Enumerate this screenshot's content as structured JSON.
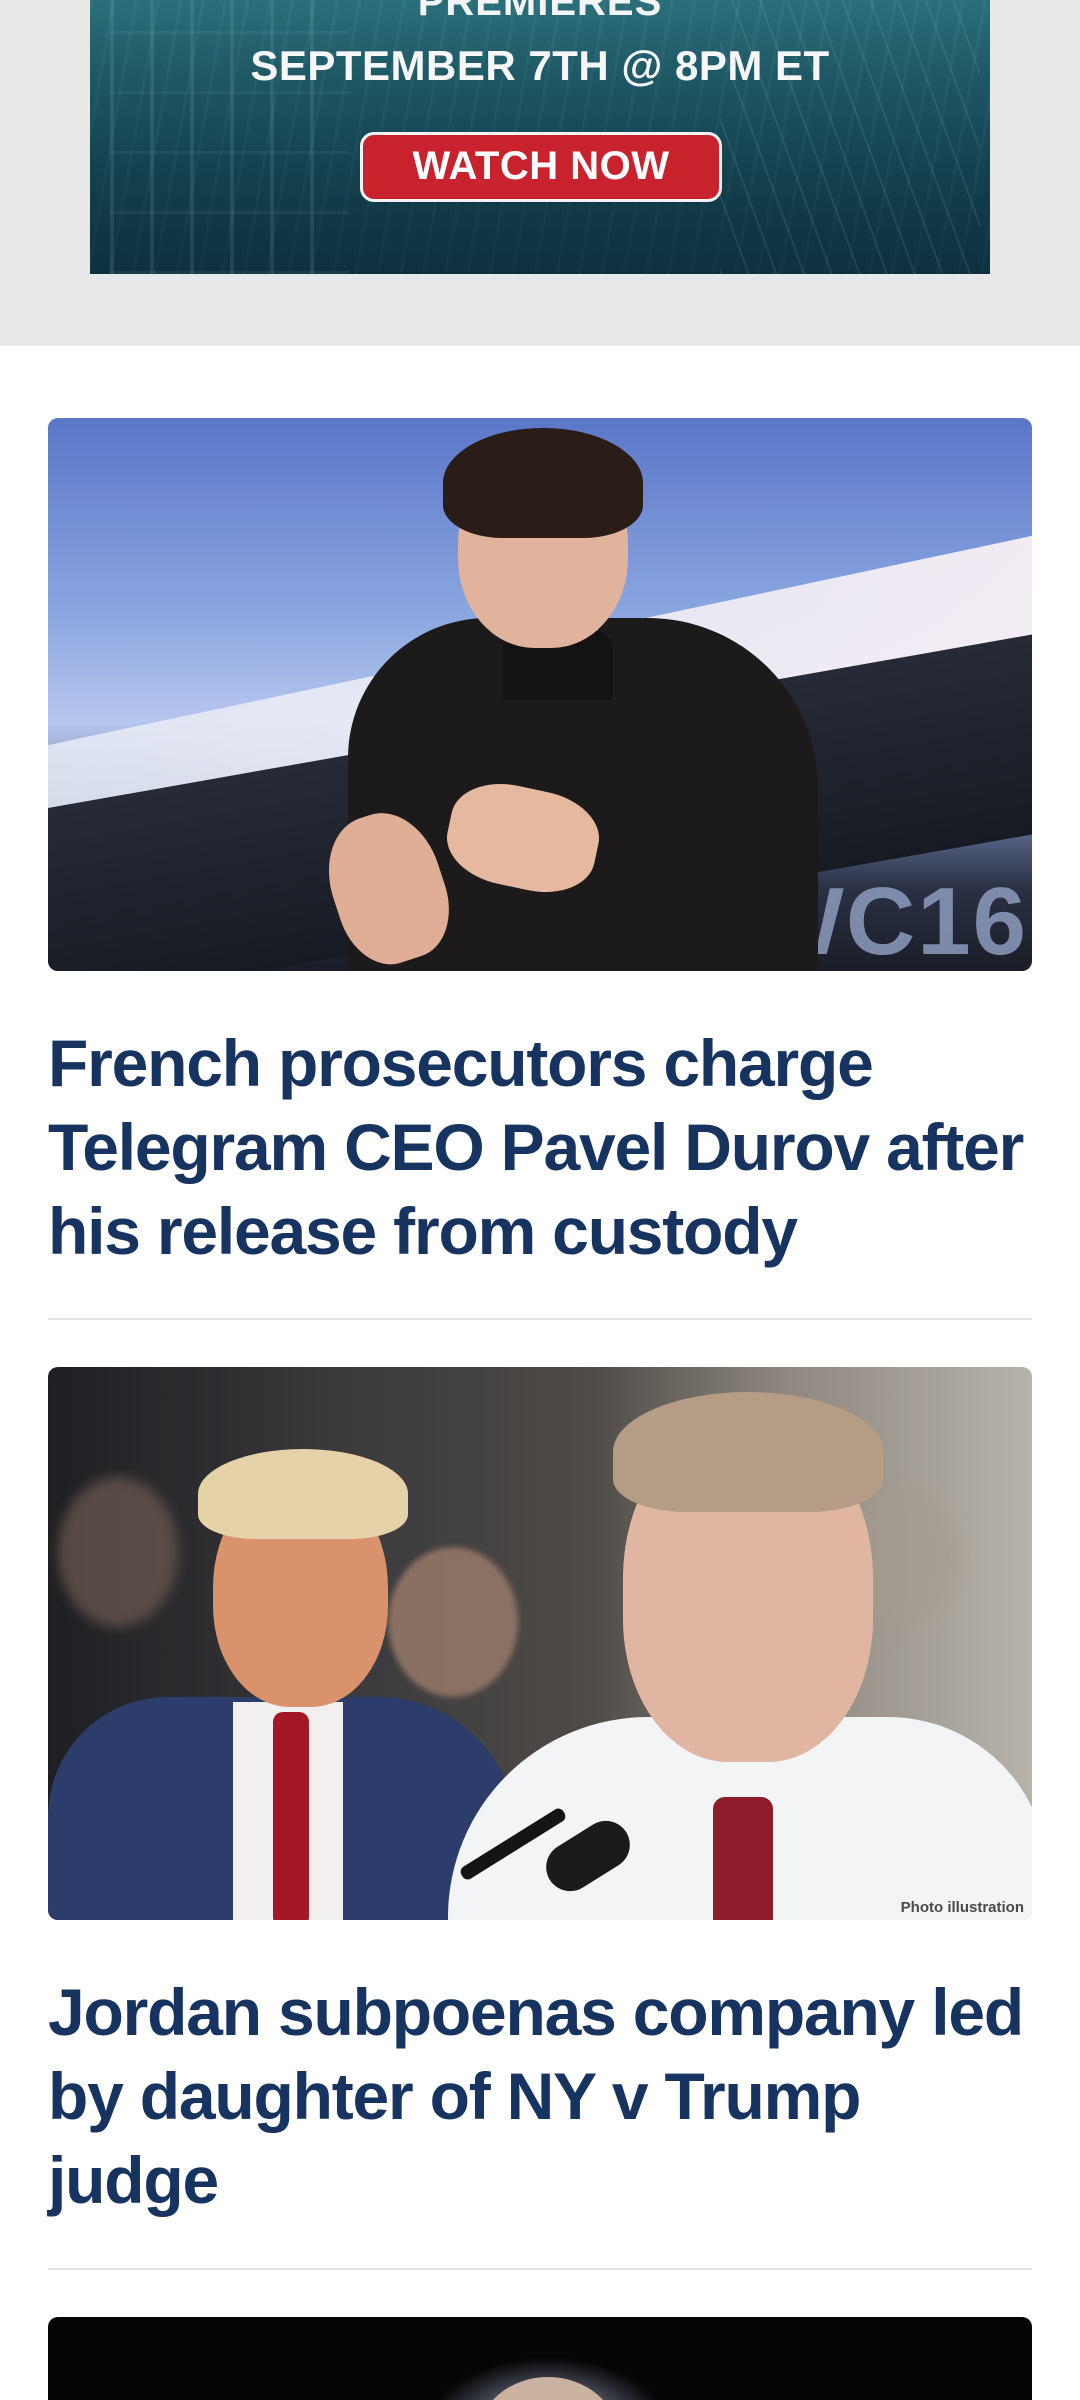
{
  "ad": {
    "premieres": "PREMIERES",
    "date": "SEPTEMBER 7TH @ 8PM ET",
    "cta": "WATCH NOW"
  },
  "articles": [
    {
      "headline": "French prosecutors charge Telegram CEO Pavel Durov after his release from custody",
      "image_overlay_text": "WC16"
    },
    {
      "headline": "Jordan subpoenas company led by daughter of NY v Trump judge",
      "image_caption": "Photo illustration"
    },
    {
      "headline": ""
    }
  ]
}
